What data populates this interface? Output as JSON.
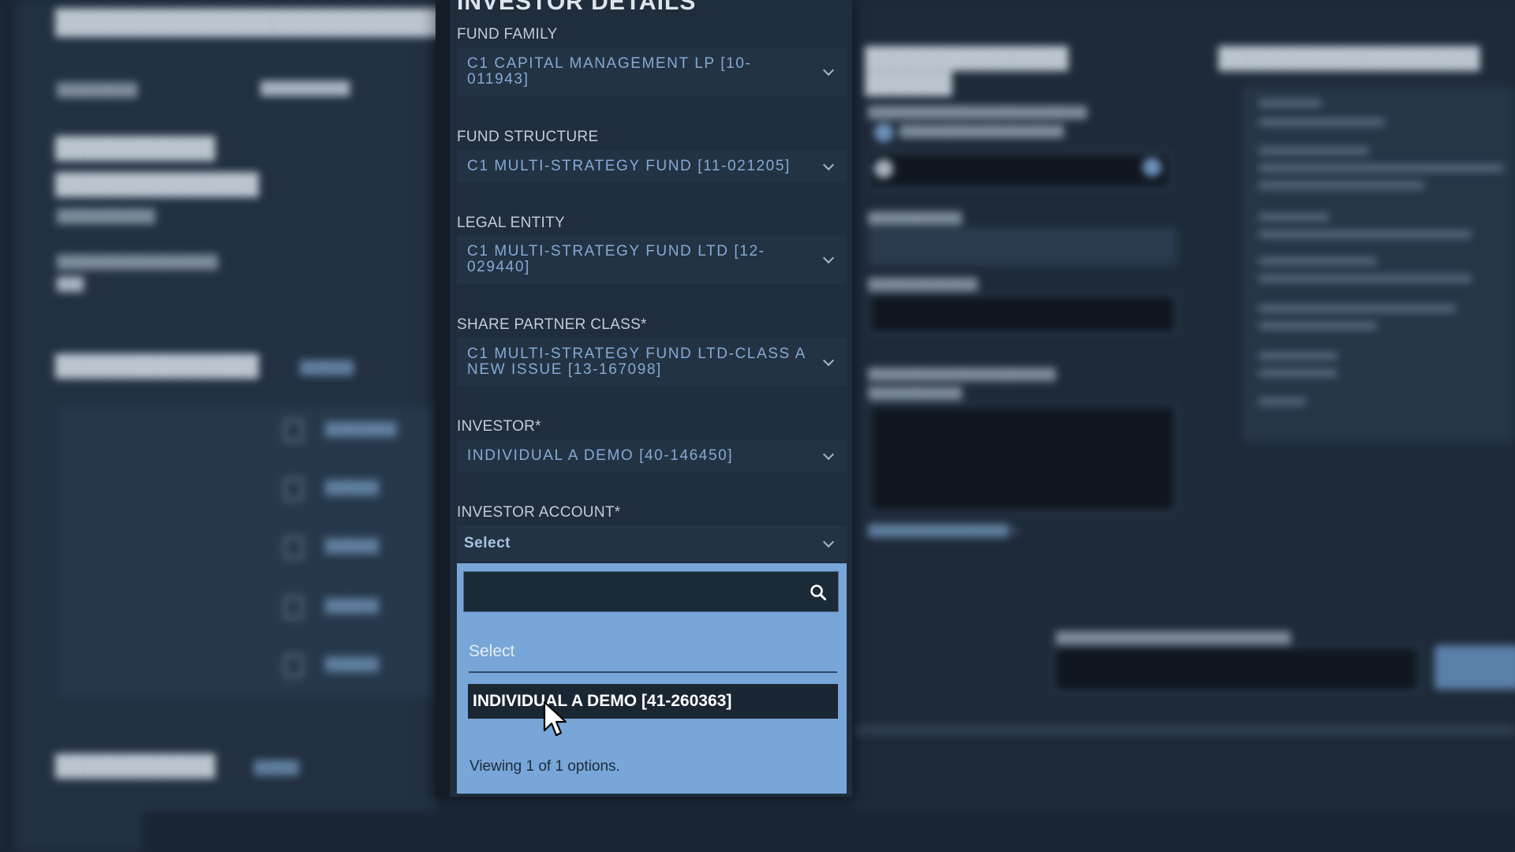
{
  "panel": {
    "title": "INVESTOR DETAILS",
    "fields": [
      {
        "label": "FUND FAMILY",
        "value": "C1 CAPITAL MANAGEMENT LP [10-011943]"
      },
      {
        "label": "FUND STRUCTURE",
        "value": "C1 MULTI-STRATEGY FUND [11-021205]"
      },
      {
        "label": "LEGAL ENTITY",
        "value": "C1 MULTI-STRATEGY FUND LTD [12-029440]"
      },
      {
        "label": "SHARE PARTNER CLASS*",
        "value": "C1 MULTI-STRATEGY FUND LTD-CLASS A NEW ISSUE [13-167098]"
      },
      {
        "label": "INVESTOR*",
        "value": "INDIVIDUAL A DEMO [40-146450]"
      },
      {
        "label": "INVESTOR ACCOUNT*",
        "value": "Select"
      }
    ]
  },
  "dropdown": {
    "search_value": "",
    "placeholder_option": "Select",
    "options": [
      "INDIVIDUAL A DEMO [41-260363]"
    ],
    "count_text": "Viewing 1 of 1 options."
  },
  "icons": {
    "search": "search-icon",
    "chevron": "chevron-down-icon",
    "cursor": "mouse-pointer-icon"
  },
  "colors": {
    "panel_bg": "#1f2d3c",
    "select_text": "#86a9d4",
    "dropdown_bg": "#78a6d8",
    "highlight_option": "#1b2633"
  }
}
